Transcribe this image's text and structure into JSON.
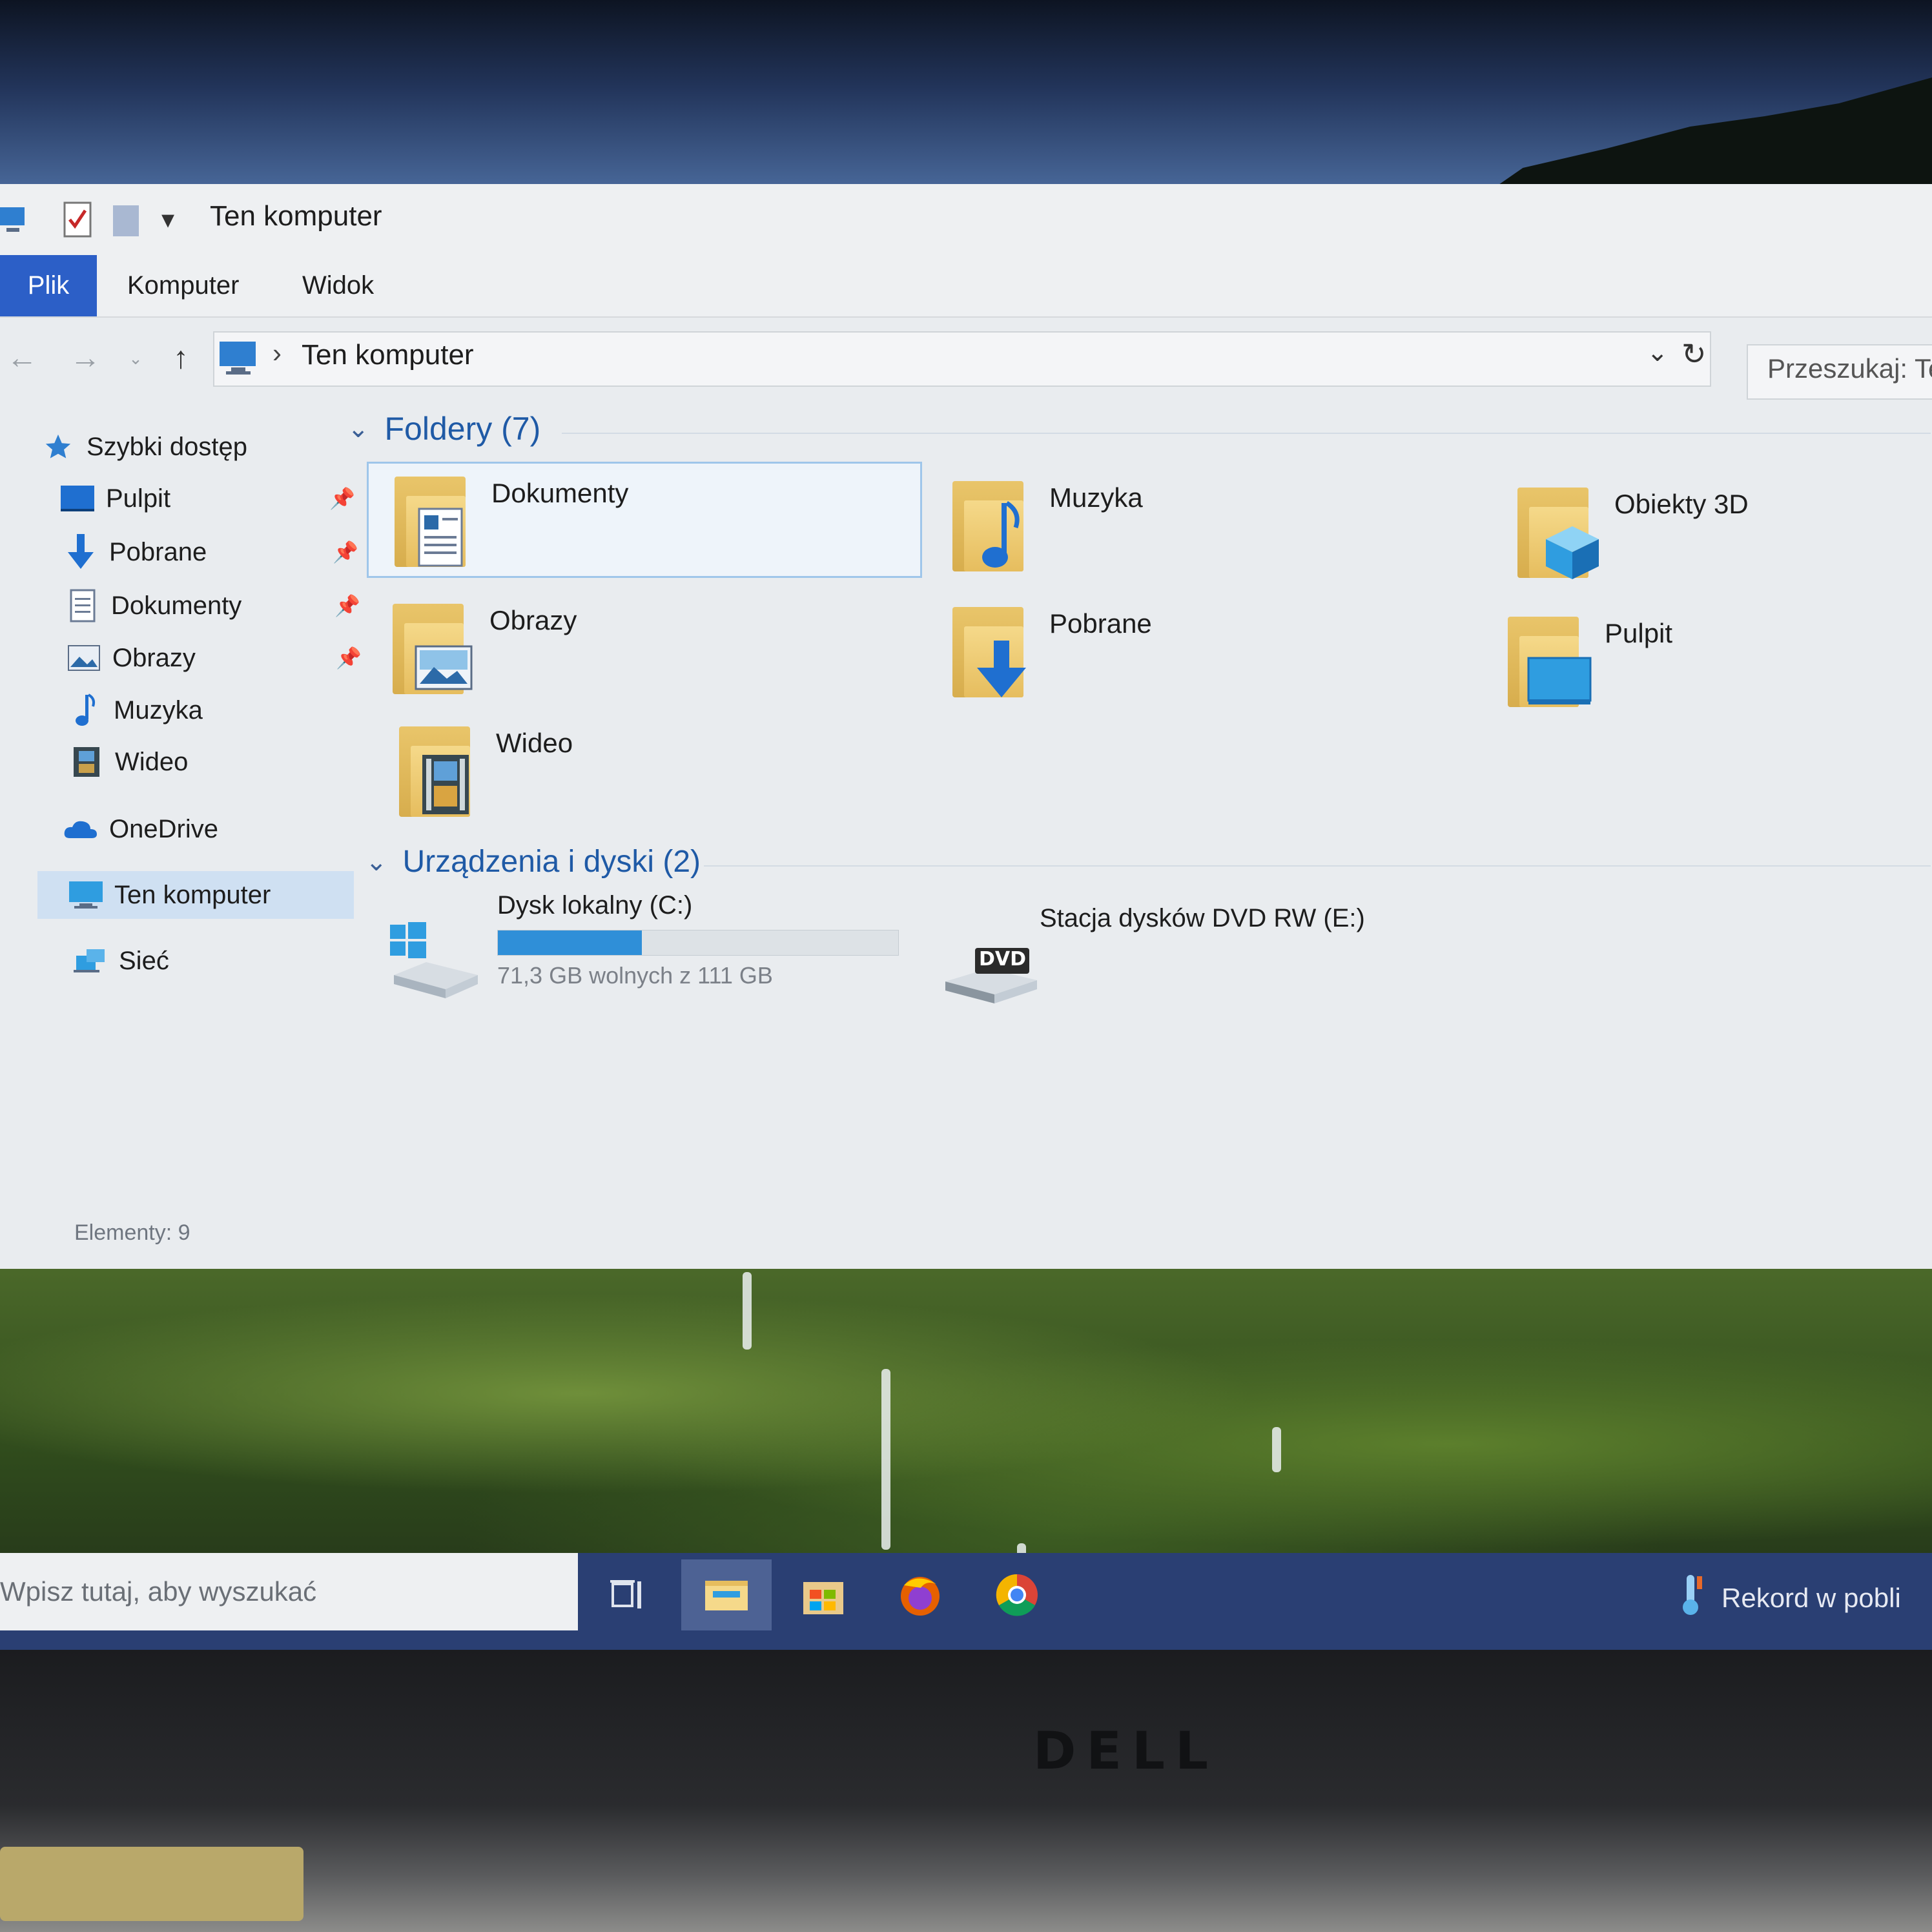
{
  "window": {
    "title": "Ten komputer",
    "tabs": [
      "Plik",
      "Komputer",
      "Widok"
    ],
    "address_path": "Ten komputer",
    "search_placeholder": "Przeszukaj: Te"
  },
  "sidebar": {
    "items": [
      {
        "label": "Szybki dostęp",
        "icon": "star-icon",
        "pinned": false
      },
      {
        "label": "Pulpit",
        "icon": "desktop-icon",
        "pinned": true
      },
      {
        "label": "Pobrane",
        "icon": "download-arrow-icon",
        "pinned": true
      },
      {
        "label": "Dokumenty",
        "icon": "document-icon",
        "pinned": true
      },
      {
        "label": "Obrazy",
        "icon": "pictures-icon",
        "pinned": true
      },
      {
        "label": "Muzyka",
        "icon": "music-note-icon",
        "pinned": false
      },
      {
        "label": "Wideo",
        "icon": "film-icon",
        "pinned": false
      },
      {
        "label": "OneDrive",
        "icon": "cloud-icon",
        "pinned": false
      },
      {
        "label": "Ten komputer",
        "icon": "computer-icon",
        "pinned": false,
        "selected": true
      },
      {
        "label": "Sieć",
        "icon": "network-icon",
        "pinned": false
      }
    ]
  },
  "content": {
    "folders_header": "Foldery (7)",
    "folders": [
      {
        "label": "Dokumenty",
        "overlay": "document-icon",
        "selected": true
      },
      {
        "label": "Muzyka",
        "overlay": "music-note-icon"
      },
      {
        "label": "Obiekty 3D",
        "overlay": "cube-icon"
      },
      {
        "label": "Obrazy",
        "overlay": "landscape-picture-icon"
      },
      {
        "label": "Pobrane",
        "overlay": "download-arrow-icon"
      },
      {
        "label": "Pulpit",
        "overlay": "desktop-icon"
      },
      {
        "label": "Wideo",
        "overlay": "film-icon"
      }
    ],
    "devices_header": "Urządzenia i dyski (2)",
    "drives": [
      {
        "label": "Dysk lokalny (C:)",
        "free_text": "71,3 GB wolnych z 111 GB",
        "used_fraction": 0.36
      },
      {
        "label": "Stacja dysków DVD RW (E:)",
        "badge": "DVD"
      }
    ]
  },
  "status_bar": {
    "items_text": "Elementy: 9"
  },
  "taskbar": {
    "search_placeholder": "Wpisz tutaj, aby wyszukać",
    "news_text": "Rekord w pobli"
  },
  "laptop": {
    "logo": "DELL"
  },
  "colors": {
    "accent": "#2c5fc7",
    "group_header": "#1f5aa6",
    "taskbar": "#2a3f73",
    "drive_fill": "#2f8fd8"
  }
}
